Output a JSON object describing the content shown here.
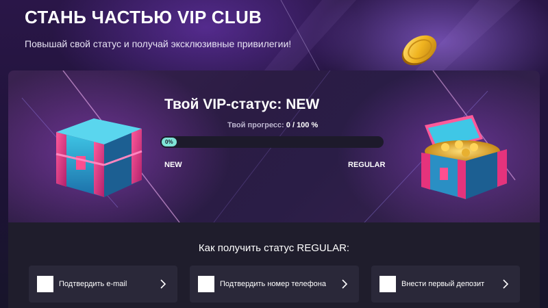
{
  "hero": {
    "title": "СТАНЬ ЧАСТЬЮ VIP CLUB",
    "subtitle": "Повышай свой статус и получай эксклюзивные привилегии!"
  },
  "vip_card": {
    "status_title": "Твой VIP-статус: NEW",
    "progress_label": "Твой прогресс:",
    "progress_value": "0 / 100 %",
    "progress_percent_text": "0%",
    "progress_fraction": 0,
    "current_level": "NEW",
    "next_level": "REGULAR"
  },
  "how_to": {
    "title": "Как получить статус REGULAR:",
    "tasks": [
      {
        "label": "Подтвердить e-mail",
        "icon": "chevron-right-icon"
      },
      {
        "label": "Подтвердить номер телефона",
        "icon": "chevron-right-icon"
      },
      {
        "label": "Внести первый депозит",
        "icon": "chevron-right-icon"
      }
    ]
  },
  "colors": {
    "accent_teal": "#7fe3d6",
    "panel_bg": "#1f1d2c",
    "task_bg": "#2a2839"
  }
}
